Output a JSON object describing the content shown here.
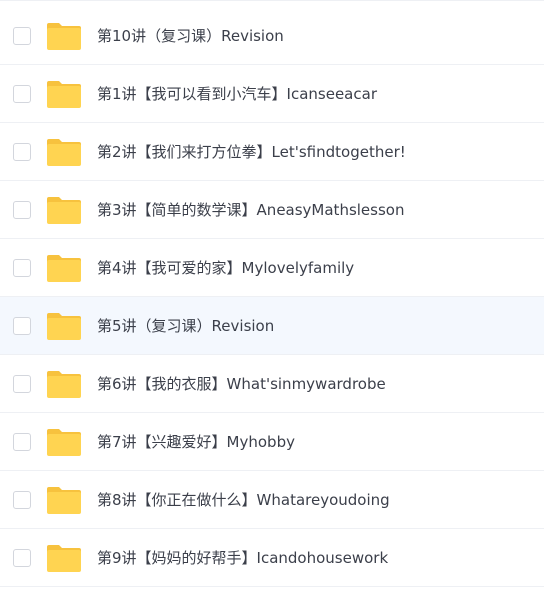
{
  "files": [
    {
      "name": "第10讲（复习课）Revision",
      "icon": "folder-icon"
    },
    {
      "name": "第1讲【我可以看到小汽车】Icanseeacar",
      "icon": "folder-icon"
    },
    {
      "name": "第2讲【我们来打方位拳】Let'sfindtogether!",
      "icon": "folder-icon"
    },
    {
      "name": "第3讲【简单的数学课】AneasyMathslesson",
      "icon": "folder-icon"
    },
    {
      "name": "第4讲【我可爱的家】Mylovelyfamily",
      "icon": "folder-icon"
    },
    {
      "name": "第5讲（复习课）Revision",
      "icon": "folder-icon"
    },
    {
      "name": "第6讲【我的衣服】What'sinmywardrobe",
      "icon": "folder-icon"
    },
    {
      "name": "第7讲【兴趣爱好】Myhobby",
      "icon": "folder-icon"
    },
    {
      "name": "第8讲【你正在做什么】Whatareyoudoing",
      "icon": "folder-icon"
    },
    {
      "name": "第9讲【妈妈的好帮手】Icandohousework",
      "icon": "folder-icon"
    }
  ],
  "colors": {
    "folder": "#ffd451",
    "folder_tab": "#f7c23e",
    "hover_row": "#f4f8fe",
    "divider": "#eef0f4",
    "text": "#3b3f4a"
  }
}
